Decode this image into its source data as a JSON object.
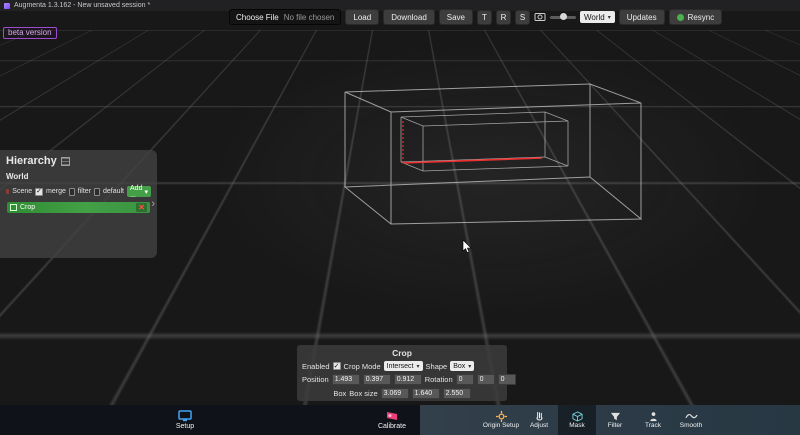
{
  "icons": {
    "check": "✓",
    "chevron_down": "▾",
    "chevron_right": "›",
    "close": "✕"
  },
  "title_bar": {
    "title": "Augmenta 1.3.162 - New unsaved session *"
  },
  "beta_badge": "beta version",
  "toolbar": {
    "choose_file": "Choose File",
    "no_file_chosen": "No file chosen",
    "load": "Load",
    "download": "Download",
    "save": "Save",
    "translate": "T",
    "rotate": "R",
    "scale": "S",
    "world_select": "World",
    "updates": "Updates",
    "resync": "Resync"
  },
  "hierarchy": {
    "title": "Hierarchy",
    "root": "World",
    "scene_label": "Scene",
    "merge_label": "merge",
    "filter_label": "filter",
    "default_label": "default",
    "add_button": "Add ...",
    "items": [
      {
        "label": "Crop"
      }
    ]
  },
  "crop_panel": {
    "title": "Crop",
    "enabled_label": "Enabled",
    "crop_mode_label": "Crop Mode",
    "crop_mode_value": "Intersect",
    "shape_label": "Shape",
    "shape_value": "Box",
    "position_label": "Position",
    "position": [
      "1.493",
      "0.397",
      "0.912"
    ],
    "rotation_label": "Rotation",
    "rotation": [
      "0",
      "0",
      "0"
    ],
    "box_label": "Box",
    "box_size_label": "Box size",
    "box_size": [
      "3.069",
      "1.640",
      "2.550"
    ]
  },
  "bottom_bar": {
    "setup": "Setup",
    "calibrate": "Calibrate",
    "tabs": [
      {
        "label": "Origin Setup",
        "selected": false
      },
      {
        "label": "Adjust",
        "selected": false
      },
      {
        "label": "Mask",
        "selected": true
      },
      {
        "label": "Filter",
        "selected": false
      },
      {
        "label": "Track",
        "selected": false
      },
      {
        "label": "Smooth",
        "selected": false
      }
    ]
  },
  "colors": {
    "accent_green": "#43a047",
    "accent_blue": "#42a5f5",
    "accent_pink": "#ec407a",
    "wireframe": "#c0c0c0",
    "crop_line_red": "#f03030",
    "beta_purple": "#9c4dcc"
  }
}
